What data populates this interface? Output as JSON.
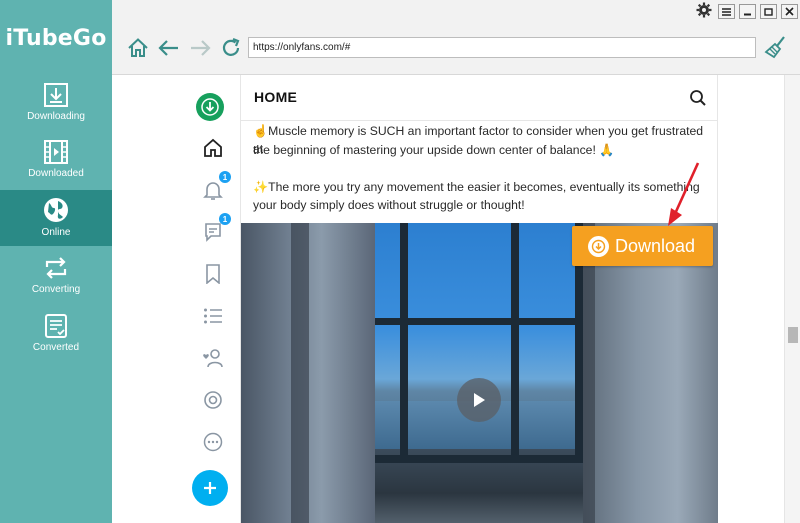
{
  "app": {
    "name": "iTubeGo",
    "accent_color": "#5fb3b0",
    "active_color": "#2a8a86"
  },
  "sidebar": {
    "items": [
      {
        "label": "Downloading",
        "icon": "download-tray-icon"
      },
      {
        "label": "Downloaded",
        "icon": "film-icon"
      },
      {
        "label": "Online",
        "icon": "globe-icon",
        "active": true
      },
      {
        "label": "Converting",
        "icon": "convert-arrows-icon"
      },
      {
        "label": "Converted",
        "icon": "document-check-icon"
      }
    ]
  },
  "toolbar": {
    "url": "https://onlyfans.com/#",
    "window_buttons": [
      "gear-icon",
      "menu-icon",
      "minimize-icon",
      "maximize-icon",
      "close-icon"
    ]
  },
  "site": {
    "header_title": "HOME",
    "badges": {
      "notifications": "1",
      "messages": "1"
    },
    "nav_icons": [
      "home-icon",
      "bell-icon",
      "message-icon",
      "bookmark-icon",
      "list-icon",
      "person-heart-icon",
      "coin-icon",
      "more-icon",
      "plus-icon"
    ],
    "brand_color": "#00aff0"
  },
  "post": {
    "line1": "☝️Muscle memory is SUCH an important factor to consider when you get frustrated at",
    "line2": "the beginning of mastering your upside down center of balance! 🙏",
    "line3": "✨The more you try any movement the easier it becomes, eventually its something",
    "line4": "your body simply does without struggle or thought!"
  },
  "overlay": {
    "download_label": "Download",
    "button_color": "#f5a020",
    "arrow_color": "#e0202a"
  }
}
